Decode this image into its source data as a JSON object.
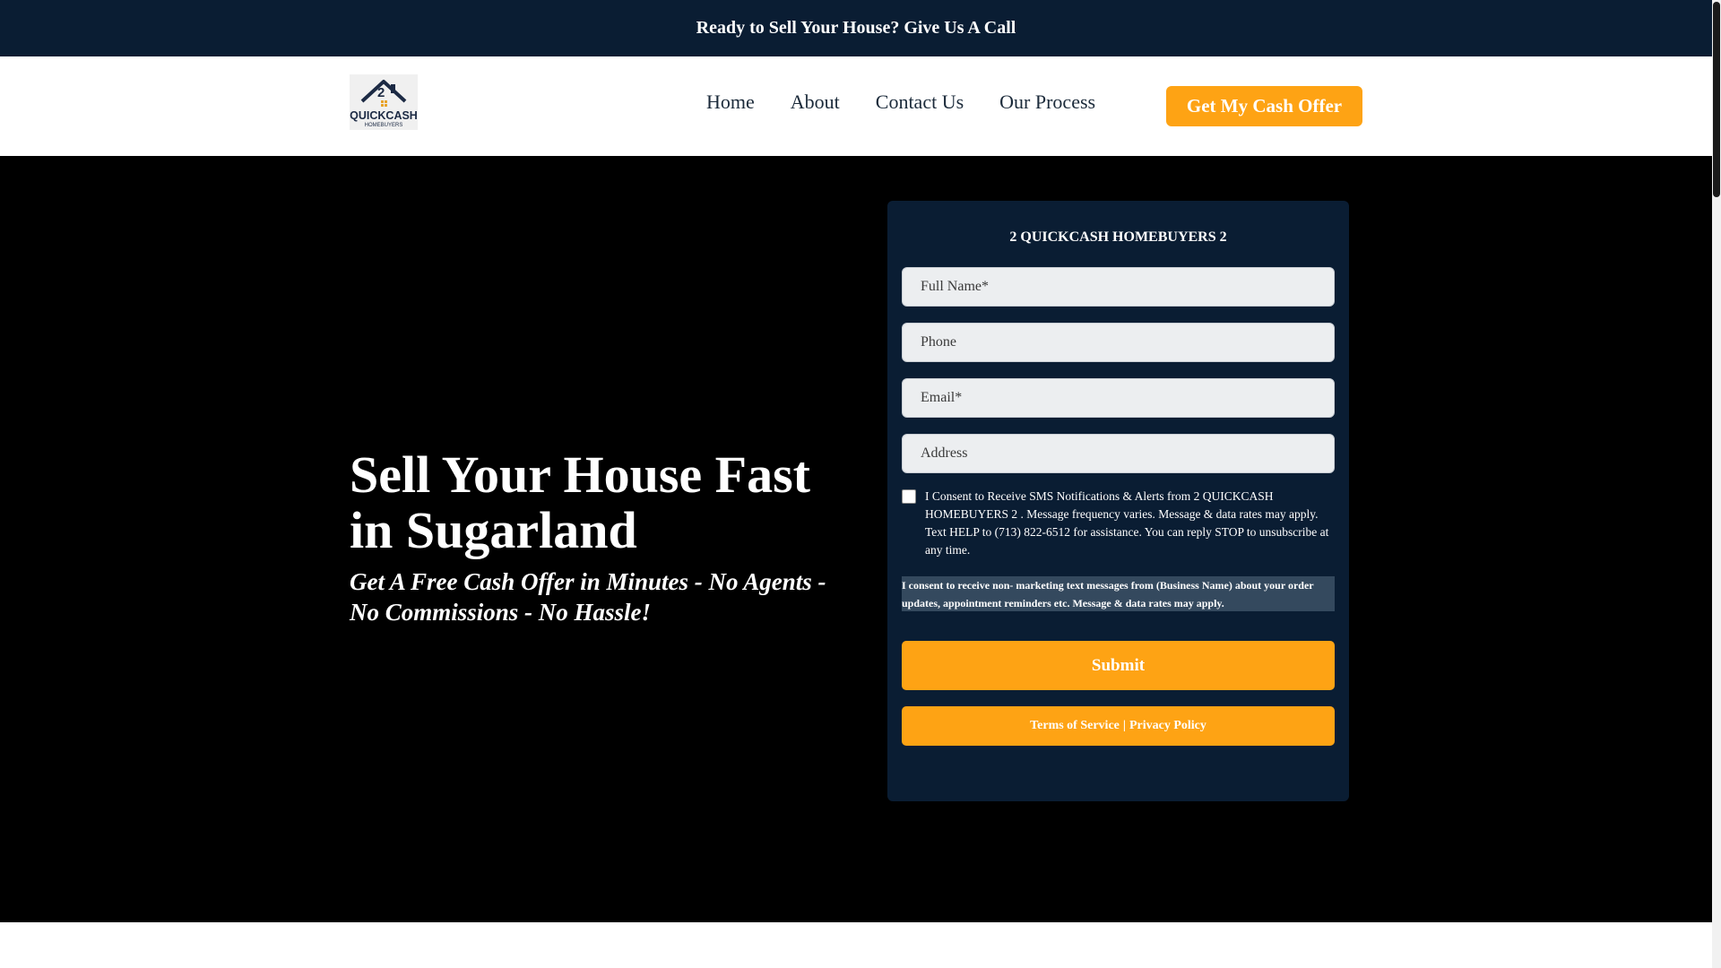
{
  "top_banner": {
    "text": "Ready to Sell Your House? Give Us A Call"
  },
  "logo": {
    "number": "2",
    "line1": "QUICKCASH",
    "line2": "HOMEBUYERS"
  },
  "nav": {
    "items": [
      "Home",
      "About",
      "Contact Us",
      "Our Process"
    ]
  },
  "cta": {
    "label": "Get My Cash Offer"
  },
  "hero": {
    "title": "Sell Your House Fast in Sugarland",
    "subtitle": "Get A Free Cash Offer in Minutes - No Agents - No Commissions - No Hassle!"
  },
  "form": {
    "title": "2 QUICKCASH HOMEBUYERS 2",
    "fields": {
      "full_name": {
        "placeholder": "Full Name*",
        "value": ""
      },
      "phone": {
        "placeholder": "Phone",
        "value": ""
      },
      "email": {
        "placeholder": "Email*",
        "value": ""
      },
      "address": {
        "placeholder": "Address",
        "value": ""
      }
    },
    "consent": {
      "checked": false,
      "text": "I Consent to Receive SMS Notifications & Alerts from 2 QUICKCASH HOMEBUYERS 2 . Message frequency varies. Message & data rates may apply. Text HELP to (713) 822-6512 for assistance. You can reply STOP to unsubscribe at any time."
    },
    "notice": "I consent to receive non- marketing text messages from (Business Name) about your order updates, appointment reminders etc. Message & data rates may apply.",
    "submit_label": "Submit",
    "terms_label": "Terms of Service",
    "separator": "|",
    "privacy_label": "Privacy Policy"
  },
  "colors": {
    "navy": "#0a1d33",
    "accent": "#fea314",
    "hero_bg": "#000000",
    "notice_bg": "#34495e"
  },
  "icons": [
    "house-logo-icon",
    "checkbox-icon"
  ]
}
